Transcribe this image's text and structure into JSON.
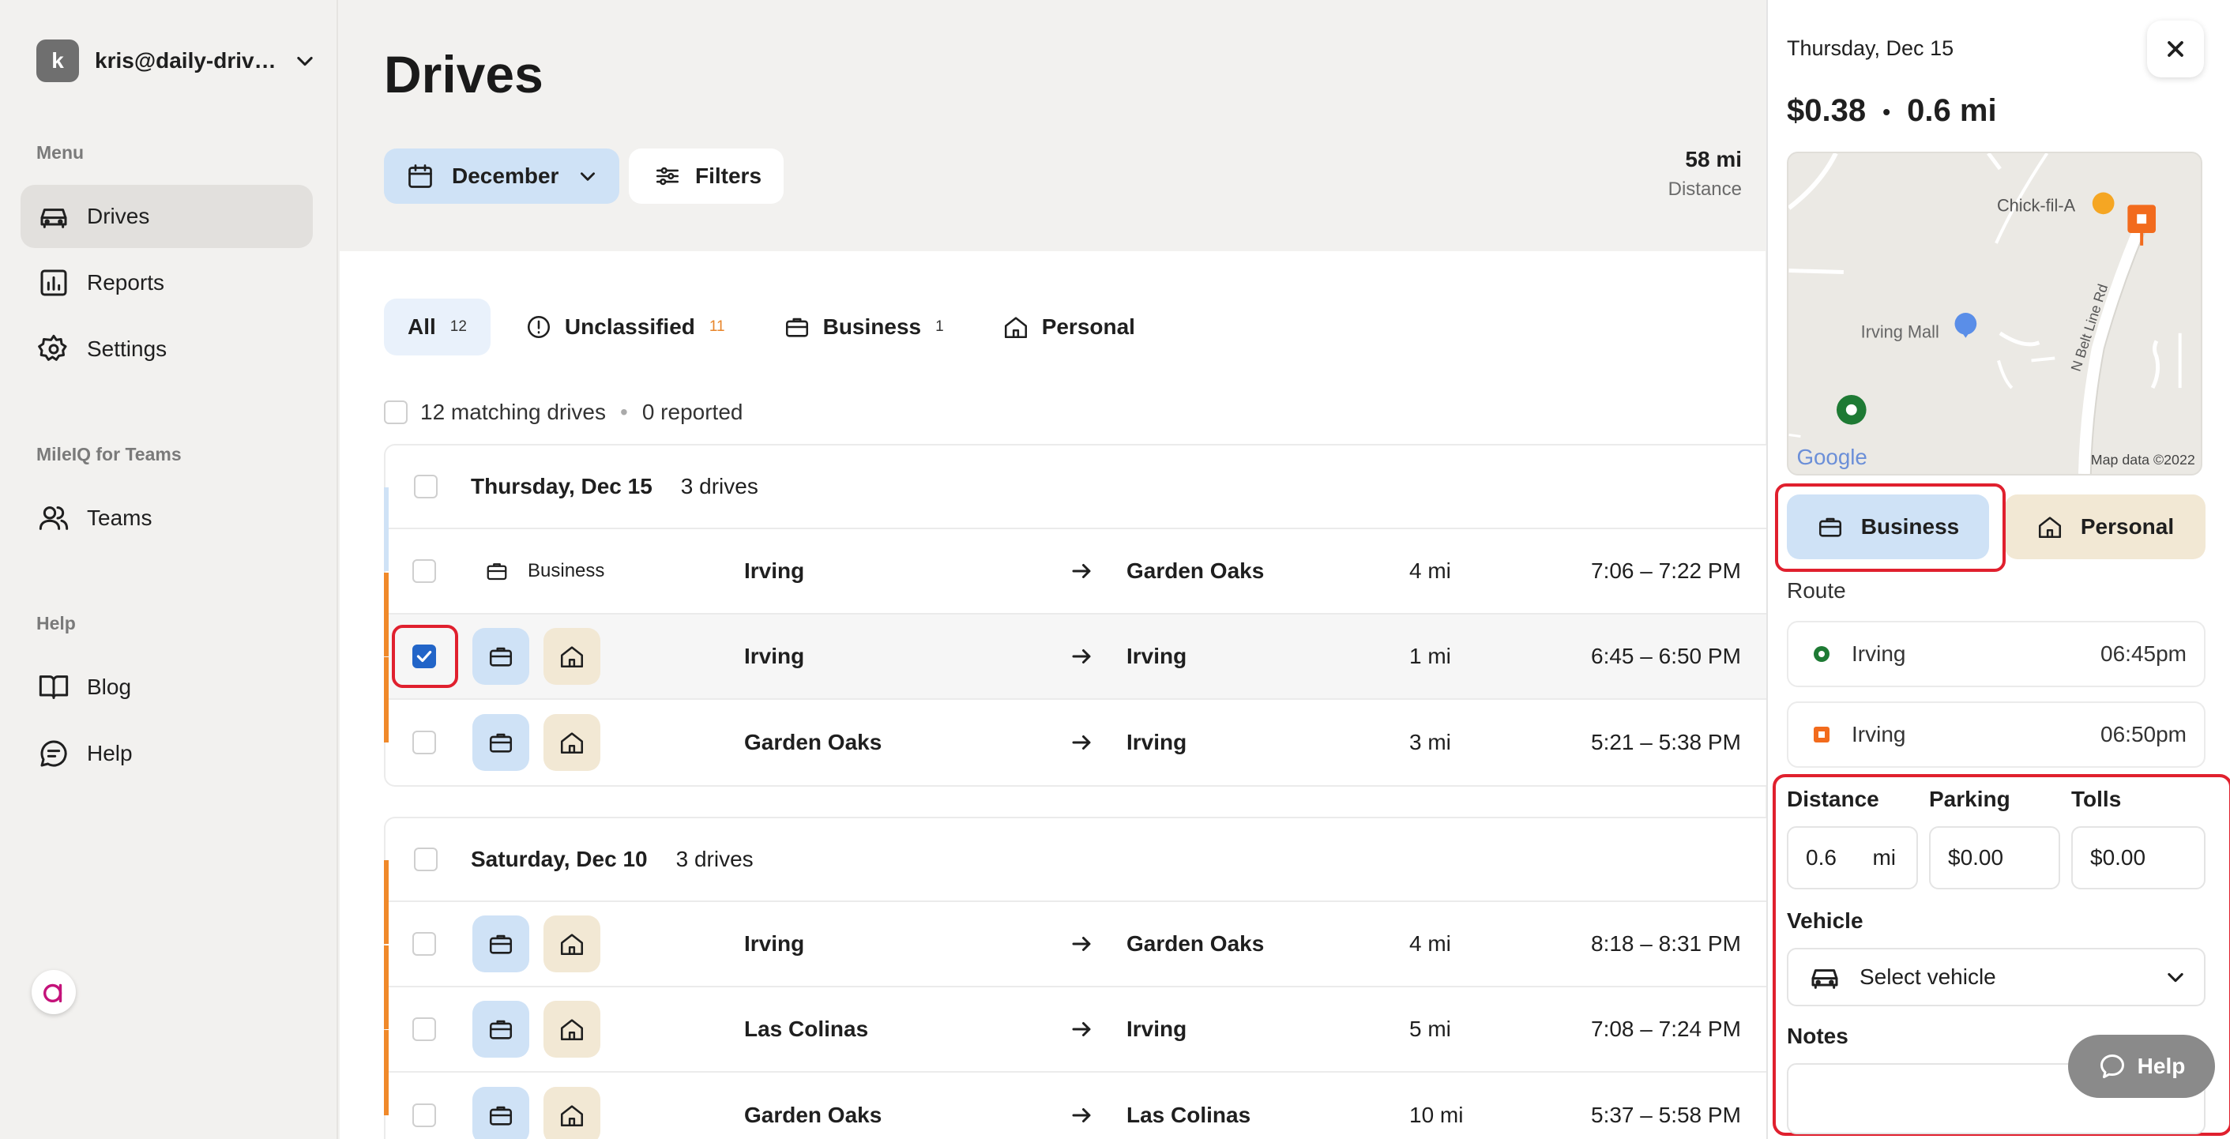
{
  "account": {
    "initial": "k",
    "email": "kris@daily-drive..."
  },
  "sidebar": {
    "menu_label": "Menu",
    "items": [
      {
        "label": "Drives",
        "icon": "car-icon",
        "active": true
      },
      {
        "label": "Reports",
        "icon": "chart-icon"
      },
      {
        "label": "Settings",
        "icon": "gear-icon"
      }
    ],
    "teams_label": "MileIQ for Teams",
    "teams_item": {
      "label": "Teams",
      "icon": "users-icon"
    },
    "help_label": "Help",
    "help_items": [
      {
        "label": "Blog",
        "icon": "book-icon"
      },
      {
        "label": "Help",
        "icon": "chat-icon"
      }
    ]
  },
  "header": {
    "title": "Drives",
    "month_label": "December",
    "filters_label": "Filters",
    "distance_value": "58 mi",
    "distance_label": "Distance"
  },
  "tabs": [
    {
      "label": "All",
      "count": "12"
    },
    {
      "label": "Unclassified",
      "count": "11"
    },
    {
      "label": "Business",
      "count": "1"
    },
    {
      "label": "Personal",
      "count": ""
    }
  ],
  "summary": {
    "matching": "12 matching drives",
    "separator": "•",
    "reported": "0 reported"
  },
  "groups": [
    {
      "date": "Thursday, Dec 15",
      "count": "3 drives",
      "rows": [
        {
          "type": "business",
          "classification": "Business",
          "from": "Irving",
          "to": "Garden Oaks",
          "distance": "4 mi",
          "time": "7:06 – 7:22 PM"
        },
        {
          "type": "unclassified",
          "selected": true,
          "from": "Irving",
          "to": "Irving",
          "distance": "1 mi",
          "time": "6:45 – 6:50 PM"
        },
        {
          "type": "unclassified",
          "from": "Garden Oaks",
          "to": "Irving",
          "distance": "3 mi",
          "time": "5:21 – 5:38 PM"
        }
      ]
    },
    {
      "date": "Saturday, Dec 10",
      "count": "3 drives",
      "rows": [
        {
          "type": "unclassified",
          "from": "Irving",
          "to": "Garden Oaks",
          "distance": "4 mi",
          "time": "8:18 – 8:31 PM"
        },
        {
          "type": "unclassified",
          "from": "Las Colinas",
          "to": "Irving",
          "distance": "5 mi",
          "time": "7:08 – 7:24 PM"
        },
        {
          "type": "unclassified",
          "from": "Garden Oaks",
          "to": "Las Colinas",
          "distance": "10 mi",
          "time": "5:37 – 5:58 PM"
        }
      ]
    }
  ],
  "detail": {
    "date": "Thursday, Dec 15",
    "amount": "$0.38",
    "separator": "•",
    "distance": "0.6 mi",
    "map": {
      "labels": [
        "Chick-fil-A",
        "Irving Mall",
        "N Belt Line Rd"
      ],
      "google": "Google",
      "attribution": "Map data ©2022"
    },
    "business_label": "Business",
    "personal_label": "Personal",
    "route_label": "Route",
    "stops": [
      {
        "place": "Irving",
        "time": "06:45pm",
        "color": "#1e7a34"
      },
      {
        "place": "Irving",
        "time": "06:50pm",
        "color": "#f26b1d"
      }
    ],
    "distance_label": "Distance",
    "parking_label": "Parking",
    "tolls_label": "Tolls",
    "distance_value": "0.6",
    "distance_unit": "mi",
    "parking_value": "$0.00",
    "tolls_value": "$0.00",
    "vehicle_label": "Vehicle",
    "vehicle_placeholder": "Select vehicle",
    "notes_label": "Notes"
  },
  "help_button": "Help"
}
